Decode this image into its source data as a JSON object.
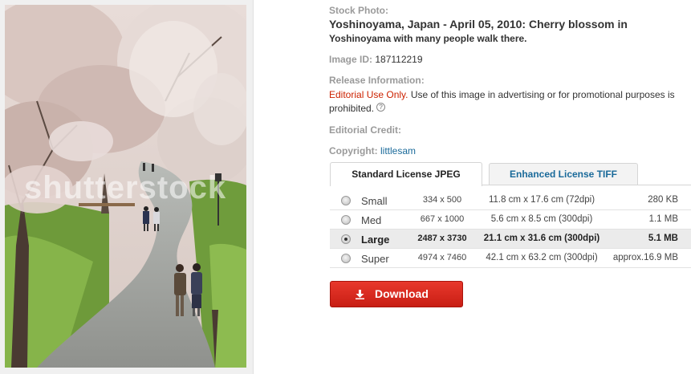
{
  "photo": {
    "watermark": "shutterstock"
  },
  "details": {
    "stock_photo_label": "Stock Photo:",
    "title": "Yoshinoyama, Japan - April 05, 2010: Cherry blossom in",
    "subtitle": "Yoshinoyama with many people walk there.",
    "image_id_label": "Image ID:",
    "image_id": "187112219",
    "release_label": "Release Information:",
    "editorial_use": "Editorial Use Only.",
    "release_text": " Use of this image in advertising or for promotional purposes is prohibited.",
    "editorial_credit_label": "Editorial Credit:",
    "copyright_label": "Copyright:",
    "copyright_value": "littlesam"
  },
  "tabs": {
    "standard": "Standard License JPEG",
    "enhanced": "Enhanced License TIFF"
  },
  "sizes": [
    {
      "name": "Small",
      "pixels": "334 x 500",
      "print": "11.8 cm x 17.6 cm  (72dpi)",
      "file": "280 KB",
      "selected": false
    },
    {
      "name": "Med",
      "pixels": "667 x 1000",
      "print": "5.6 cm x 8.5 cm  (300dpi)",
      "file": "1.1 MB",
      "selected": false
    },
    {
      "name": "Large",
      "pixels": "2487 x 3730",
      "print": "21.1 cm x 31.6 cm  (300dpi)",
      "file": "5.1 MB",
      "selected": true
    },
    {
      "name": "Super",
      "pixels": "4974 x 7460",
      "print": "42.1 cm x 63.2 cm  (300dpi)",
      "file": "approx.16.9 MB",
      "selected": false
    }
  ],
  "download": {
    "label": "Download"
  },
  "colors": {
    "editorial_red": "#cc2200",
    "link_blue": "#1a6a9a",
    "download_red": "#d42a1e"
  }
}
